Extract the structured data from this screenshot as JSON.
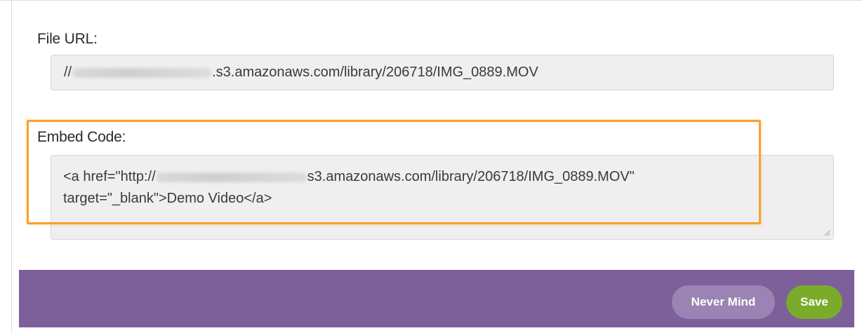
{
  "file_url": {
    "label": "File URL:",
    "prefix": "//",
    "suffix": ".s3.amazonaws.com/library/206718/IMG_0889.MOV"
  },
  "embed_code": {
    "label": "Embed Code:",
    "line1_prefix": "<a href=\"http://",
    "line1_suffix": "s3.amazonaws.com/library/206718/IMG_0889.MOV\"",
    "line2": "target=\"_blank\">Demo Video</a>"
  },
  "footer": {
    "never_mind_label": "Never Mind",
    "save_label": "Save"
  },
  "colors": {
    "footer_bg": "#7d5f9a",
    "never_mind_bg": "#9b83b3",
    "save_bg": "#7bab2a",
    "highlight_border": "#f7a12e",
    "field_bg": "#efefef"
  }
}
